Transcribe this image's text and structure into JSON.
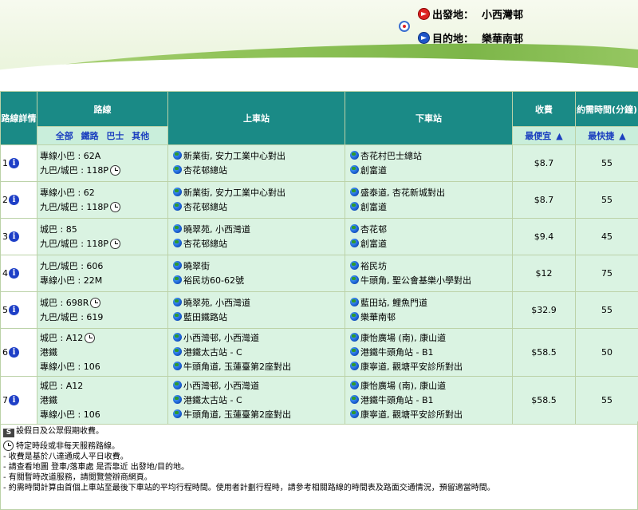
{
  "header": {
    "from_label": "出發地：",
    "from_value": "小西灣邨",
    "to_label": "目的地：",
    "to_value": "樂華南邨"
  },
  "table": {
    "col_detail": "路線詳情",
    "col_route": "路線",
    "col_board": "上車站",
    "col_alight": "下車站",
    "col_fare": "收費",
    "col_time": "約需時間(分鐘)",
    "filters": [
      "全部",
      "鐵路",
      "巴士",
      "其他"
    ],
    "sort_cheapest": "最便宜",
    "sort_fastest": "最快捷",
    "rows": [
      {
        "index": "1",
        "routes": [
          {
            "text": "專線小巴 : 62A",
            "clock": false
          },
          {
            "text": "九巴/城巴 : 118P",
            "clock": true
          }
        ],
        "board": [
          "新業街, 安力工業中心對出",
          "杏花邨總站"
        ],
        "alight": [
          "杏花村巴士總站",
          "創富道"
        ],
        "fare": "$8.7",
        "time": "55"
      },
      {
        "index": "2",
        "routes": [
          {
            "text": "專線小巴 : 62",
            "clock": false
          },
          {
            "text": "九巴/城巴 : 118P",
            "clock": true
          }
        ],
        "board": [
          "新業街, 安力工業中心對出",
          "杏花邨總站"
        ],
        "alight": [
          "盛泰道, 杏花新城對出",
          "創富道"
        ],
        "fare": "$8.7",
        "time": "55"
      },
      {
        "index": "3",
        "routes": [
          {
            "text": "城巴 : 85",
            "clock": false
          },
          {
            "text": "九巴/城巴 : 118P",
            "clock": true
          }
        ],
        "board": [
          "曉翠苑, 小西灣道",
          "杏花邨總站"
        ],
        "alight": [
          "杏花邨",
          "創富道"
        ],
        "fare": "$9.4",
        "time": "45"
      },
      {
        "index": "4",
        "routes": [
          {
            "text": "九巴/城巴 : 606",
            "clock": false
          },
          {
            "text": "專線小巴 : 22M",
            "clock": false
          }
        ],
        "board": [
          "曉翠街",
          "裕民坊60-62號"
        ],
        "alight": [
          "裕民坊",
          "牛頭角, 聖公會基樂小學對出"
        ],
        "fare": "$12",
        "time": "75"
      },
      {
        "index": "5",
        "routes": [
          {
            "text": "城巴 : 698R",
            "clock": true
          },
          {
            "text": "九巴/城巴 : 619",
            "clock": false
          }
        ],
        "board": [
          "曉翠苑, 小西灣道",
          "藍田鐵路站"
        ],
        "alight": [
          "藍田站, 鯉魚門道",
          "樂華南邨"
        ],
        "fare": "$32.9",
        "time": "55"
      },
      {
        "index": "6",
        "routes": [
          {
            "text": "城巴 : A12",
            "clock": true
          },
          {
            "text": "港鐵",
            "clock": false
          },
          {
            "text": "專線小巴 : 106",
            "clock": false
          }
        ],
        "board": [
          "小西灣邨, 小西灣道",
          "港鐵太古站 - C",
          "牛頭角道, 玉蓮臺第2座對出"
        ],
        "alight": [
          "康怡廣場 (南), 康山道",
          "港鐵牛頭角站 - B1",
          "康寧道, 觀塘平安診所對出"
        ],
        "fare": "$58.5",
        "time": "50"
      },
      {
        "index": "7",
        "routes": [
          {
            "text": "城巴 : A12",
            "clock": false
          },
          {
            "text": "港鐵",
            "clock": false
          },
          {
            "text": "專線小巴 : 106",
            "clock": false
          }
        ],
        "board": [
          "小西灣邨, 小西灣道",
          "港鐵太古站 - C",
          "牛頭角道, 玉蓮臺第2座對出"
        ],
        "alight": [
          "康怡廣場 (南), 康山道",
          "港鐵牛頭角站 - B1",
          "康寧道, 觀塘平安診所對出"
        ],
        "fare": "$58.5",
        "time": "55"
      }
    ]
  },
  "notes": {
    "s_badge": "S",
    "s_text": "設假日及公眾假期收費。",
    "clock_text": "特定時段或非每天服務路線。",
    "lines": [
      "- 收費是基於八達通成人平日收費。",
      "- 請查看地圖 登車/落車處 是否靠近 出發地/目的地。",
      "- 有關暫時改道服務，請閱覽營辦商網頁。",
      "- 約需時間計算由首個上車站至最後下車站的平均行程時間。使用者計劃行程時，請參考相關路線的時間表及路面交通情況，預留適當時間。"
    ]
  }
}
